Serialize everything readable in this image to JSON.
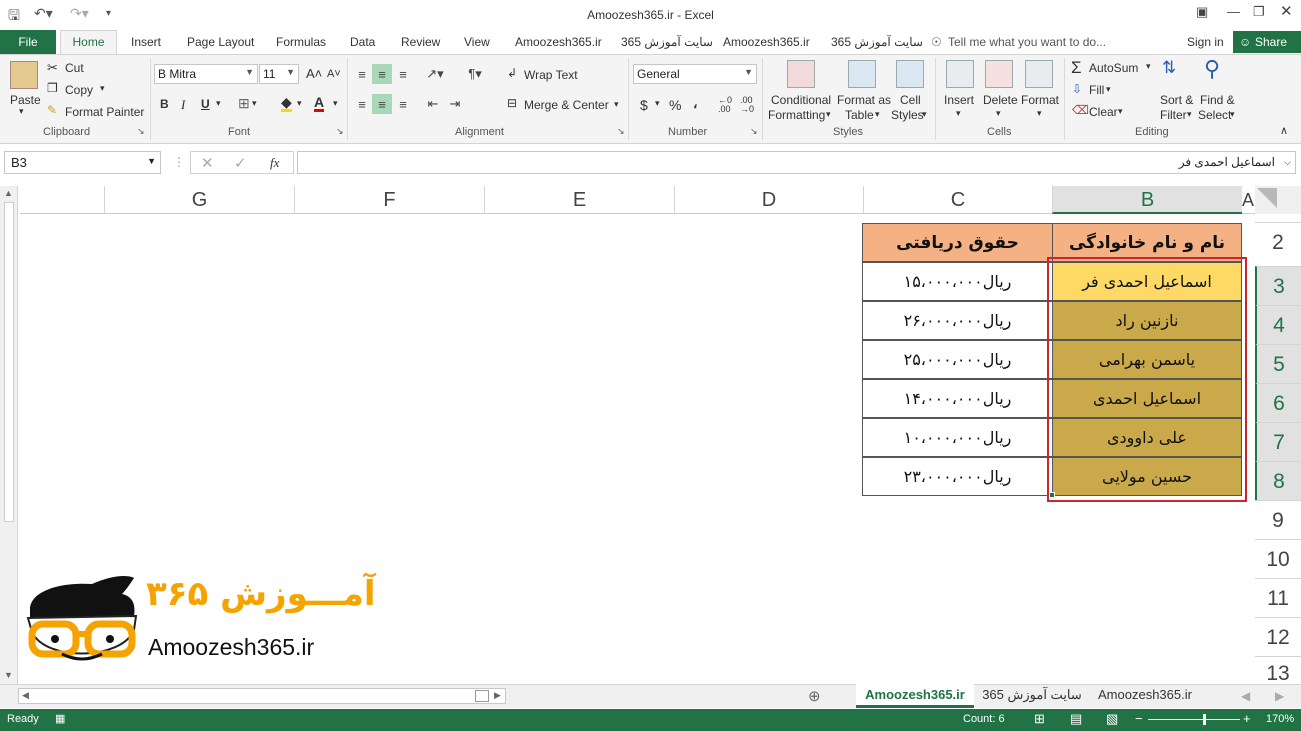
{
  "window": {
    "title": "Amoozesh365.ir - Excel"
  },
  "tabs": {
    "file": "File",
    "home": "Home",
    "insert": "Insert",
    "page_layout": "Page Layout",
    "formulas": "Formulas",
    "data": "Data",
    "review": "Review",
    "view": "View",
    "custom1": "Amoozesh365.ir",
    "custom2": "سایت آموزش 365",
    "custom3": "Amoozesh365.ir",
    "custom4": "سایت آموزش 365",
    "tell_me": "Tell me what you want to do...",
    "sign_in": "Sign in",
    "share": "Share"
  },
  "ribbon": {
    "clipboard": {
      "paste": "Paste",
      "cut": "Cut",
      "copy": "Copy",
      "format_painter": "Format Painter",
      "label": "Clipboard"
    },
    "font": {
      "name": "B Mitra",
      "size": "11",
      "bold": "B",
      "italic": "I",
      "underline": "U",
      "label": "Font"
    },
    "alignment": {
      "wrap_text": "Wrap Text",
      "merge_center": "Merge & Center",
      "label": "Alignment"
    },
    "number": {
      "format": "General",
      "currency": "$",
      "percent": "%",
      "comma": "،",
      "label": "Number"
    },
    "styles": {
      "conditional_1": "Conditional",
      "conditional_2": "Formatting",
      "format_table_1": "Format as",
      "format_table_2": "Table",
      "cell_styles_1": "Cell",
      "cell_styles_2": "Styles",
      "label": "Styles"
    },
    "cells": {
      "insert": "Insert",
      "delete": "Delete",
      "format": "Format",
      "label": "Cells"
    },
    "editing": {
      "autosum": "AutoSum",
      "fill": "Fill",
      "clear": "Clear",
      "sort_1": "Sort &",
      "sort_2": "Filter",
      "find_1": "Find &",
      "find_2": "Select",
      "label": "Editing"
    }
  },
  "formula_bar": {
    "name_box": "B3",
    "fx": "fx",
    "value": "اسماعیل احمدی فر"
  },
  "columns": [
    "G",
    "F",
    "E",
    "D",
    "C",
    "B",
    "A"
  ],
  "rows": [
    "2",
    "3",
    "4",
    "5",
    "6",
    "7",
    "8",
    "9",
    "10",
    "11",
    "12",
    "13"
  ],
  "table": {
    "header_name": "نام و نام خانوادگی",
    "header_salary": "حقوق دریافتی",
    "rows": [
      {
        "name": "اسماعیل احمدی فر",
        "salary": "۱۵،۰۰۰،۰۰۰ریال"
      },
      {
        "name": "نازنین راد",
        "salary": "۲۶،۰۰۰،۰۰۰ریال"
      },
      {
        "name": "یاسمن بهرامی",
        "salary": "۲۵،۰۰۰،۰۰۰ریال"
      },
      {
        "name": "اسماعیل احمدی",
        "salary": "۱۴،۰۰۰،۰۰۰ریال"
      },
      {
        "name": "علی داوودی",
        "salary": "۱۰،۰۰۰،۰۰۰ریال"
      },
      {
        "name": "حسین مولایی",
        "salary": "۲۳،۰۰۰،۰۰۰ریال"
      }
    ]
  },
  "logo": {
    "persian": "آمـــوزش ۳۶۵",
    "latin": "Amoozesh365.ir"
  },
  "sheet_tabs": {
    "active": "Amoozesh365.ir",
    "tab2": "سایت آموزش 365",
    "tab3": "Amoozesh365.ir"
  },
  "status": {
    "ready": "Ready",
    "count": "Count: 6",
    "zoom": "170%"
  },
  "colors": {
    "excel_green": "#217346",
    "header_fill": "#f4b183",
    "name_fill": "#c9a94a",
    "selected_fill": "#ffd966",
    "selection_border": "#d0242b",
    "logo_orange": "#f5a300"
  }
}
